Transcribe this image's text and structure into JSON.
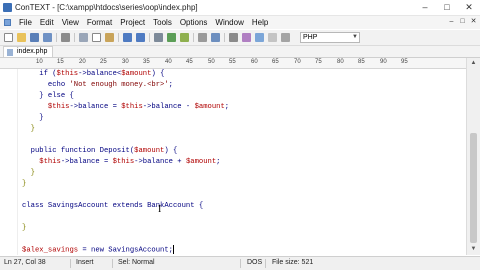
{
  "window": {
    "title": "ConTEXT - [C:\\xampp\\htdocs\\series\\oop\\index.php]",
    "minimize_icon": "minimize-icon",
    "maximize_icon": "maximize-icon",
    "close_icon": "close-icon"
  },
  "menu": {
    "items": [
      "File",
      "Edit",
      "View",
      "Format",
      "Project",
      "Tools",
      "Options",
      "Window",
      "Help"
    ]
  },
  "toolbar": {
    "highlighter_value": "PHP",
    "icons": [
      "new-file-icon",
      "open-folder-icon",
      "save-icon",
      "save-all-icon",
      "print-icon",
      "cut-icon",
      "copy-icon",
      "paste-icon",
      "undo-icon",
      "redo-icon",
      "find-icon",
      "replace-icon",
      "find-next-icon",
      "word-wrap-icon",
      "settings-icon",
      "run-icon",
      "highlighter-icon"
    ]
  },
  "tab": {
    "label": "index.php"
  },
  "ruler": {
    "labels": [
      "10",
      "15",
      "20",
      "25",
      "30",
      "35",
      "40",
      "45",
      "50",
      "55",
      "60",
      "65",
      "70",
      "75",
      "80",
      "85",
      "90",
      "95"
    ]
  },
  "code": {
    "lines": [
      {
        "segments": [
          [
            "kw",
            "    if ("
          ],
          [
            "var",
            "$this"
          ],
          [
            "kw",
            "->balance<"
          ],
          [
            "var",
            "$amount"
          ],
          [
            "kw",
            ") {"
          ]
        ]
      },
      {
        "segments": [
          [
            "kw",
            "      echo "
          ],
          [
            "str",
            "'Not enough money.<br>'"
          ],
          [
            "kw",
            ";"
          ]
        ]
      },
      {
        "segments": [
          [
            "kw",
            "    } else {"
          ]
        ]
      },
      {
        "segments": [
          [
            "var",
            "      $this"
          ],
          [
            "kw",
            "->balance = "
          ],
          [
            "var",
            "$this"
          ],
          [
            "kw",
            "->balance - "
          ],
          [
            "var",
            "$amount"
          ],
          [
            "kw",
            ";"
          ]
        ]
      },
      {
        "segments": [
          [
            "kw",
            "    }"
          ]
        ]
      },
      {
        "segments": [
          [
            "brace",
            "  }"
          ]
        ]
      },
      {
        "segments": [
          [
            "kw",
            ""
          ]
        ]
      },
      {
        "segments": [
          [
            "kw",
            "  public function Deposit("
          ],
          [
            "var",
            "$amount"
          ],
          [
            "kw",
            ") {"
          ]
        ]
      },
      {
        "segments": [
          [
            "var",
            "    $this"
          ],
          [
            "kw",
            "->balance = "
          ],
          [
            "var",
            "$this"
          ],
          [
            "kw",
            "->balance + "
          ],
          [
            "var",
            "$amount"
          ],
          [
            "kw",
            ";"
          ]
        ]
      },
      {
        "segments": [
          [
            "brace",
            "  }"
          ]
        ]
      },
      {
        "segments": [
          [
            "brace",
            "}"
          ]
        ]
      },
      {
        "segments": [
          [
            "kw",
            ""
          ]
        ]
      },
      {
        "segments": [
          [
            "kw",
            "class SavingsAccount extends BankAccount {"
          ]
        ]
      },
      {
        "segments": [
          [
            "kw",
            ""
          ]
        ]
      },
      {
        "segments": [
          [
            "brace",
            "}"
          ]
        ]
      },
      {
        "segments": [
          [
            "kw",
            ""
          ]
        ]
      },
      {
        "segments": [
          [
            "var",
            "$alex_savings"
          ],
          [
            "kw",
            " = new SavingsAccount;"
          ]
        ]
      }
    ]
  },
  "status": {
    "position": "Ln 27, Col 38",
    "mode": "Insert",
    "selection": "Sel: Normal",
    "format": "DOS",
    "filesize": "File size: 521"
  }
}
